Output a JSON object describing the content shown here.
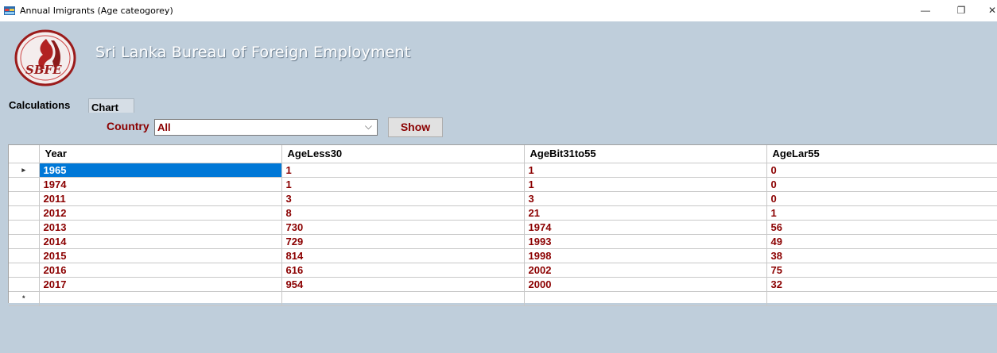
{
  "window": {
    "title": "Annual Imigrants (Age cateogorey)",
    "minimize": "—",
    "restore": "❐",
    "close": "✕"
  },
  "banner": {
    "org_name": "Sri Lanka Bureau of Foreign Employment",
    "logo_text": "SBFE"
  },
  "tabs": [
    {
      "label": "Calculations",
      "selected": true
    },
    {
      "label": "Chart",
      "selected": false
    }
  ],
  "filter": {
    "country_label": "Country",
    "country_value": "All",
    "show_label": "Show"
  },
  "grid": {
    "columns": [
      "Year",
      "AgeLess30",
      "AgeBit31to55",
      "AgeLar55"
    ],
    "current_row_marker": "▸",
    "new_row_marker": "*",
    "rows": [
      [
        "1965",
        "1",
        "1",
        "0"
      ],
      [
        "1974",
        "1",
        "1",
        "0"
      ],
      [
        "2011",
        "3",
        "3",
        "0"
      ],
      [
        "2012",
        "8",
        "21",
        "1"
      ],
      [
        "2013",
        "730",
        "1974",
        "56"
      ],
      [
        "2014",
        "729",
        "1993",
        "49"
      ],
      [
        "2015",
        "814",
        "1998",
        "38"
      ],
      [
        "2016",
        "616",
        "2002",
        "75"
      ],
      [
        "2017",
        "954",
        "2000",
        "32"
      ]
    ]
  },
  "colors": {
    "panel_bg": "#bfcedb",
    "data_text": "#8b0000",
    "selection": "#0078d7"
  }
}
